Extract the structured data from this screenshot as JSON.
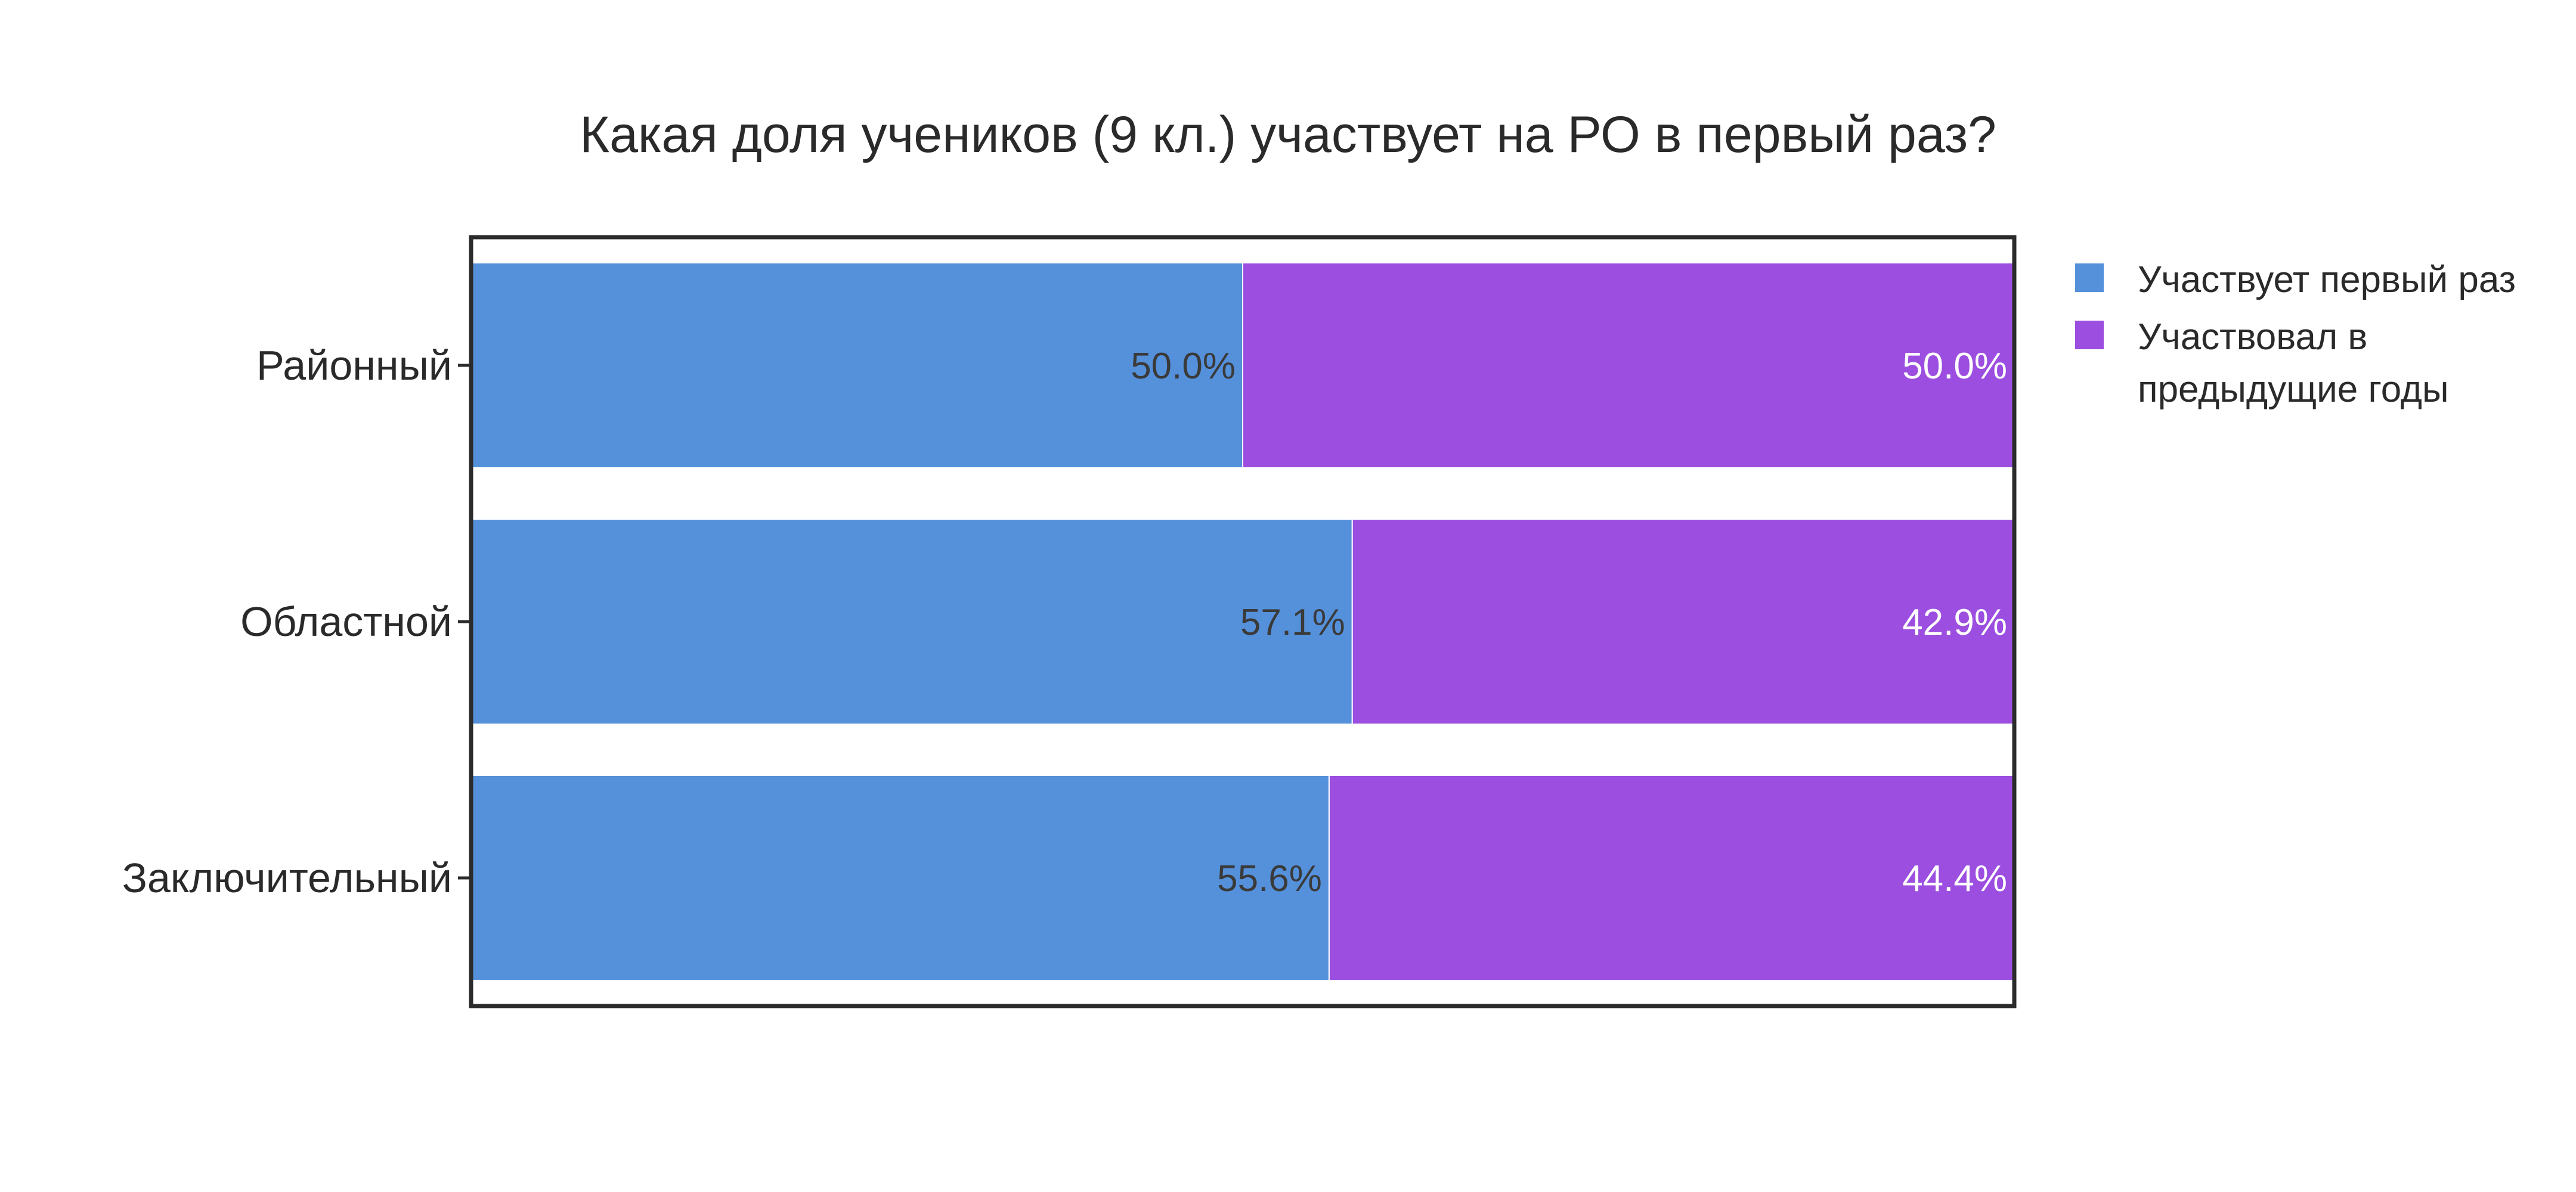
{
  "chart_data": {
    "type": "bar",
    "orientation": "horizontal",
    "stacked": true,
    "normalized_percent": true,
    "title": "Какая доля учеников (9 кл.) участвует на РО в первый раз?",
    "categories": [
      "Районный",
      "Областной",
      "Заключительный"
    ],
    "series": [
      {
        "name": "Участвует первый раз",
        "values": [
          50.0,
          57.1,
          55.6
        ],
        "labels": [
          "50.0%",
          "57.1%",
          "55.6%"
        ],
        "color": "#5591DB",
        "label_color": "#3a3a3a"
      },
      {
        "name": "Участвовал в предыдущие годы",
        "values": [
          50.0,
          42.9,
          44.4
        ],
        "labels": [
          "50.0%",
          "42.9%",
          "44.4%"
        ],
        "color": "#9B4EDF",
        "label_color": "#ffffff"
      }
    ],
    "legend_lines": [
      [
        "Участвует первый раз"
      ],
      [
        "Участвовал в",
        "предыдущие годы"
      ]
    ],
    "xlim": [
      0,
      100
    ],
    "xaxis_visible": false,
    "grid": false,
    "legend_position": "right"
  }
}
